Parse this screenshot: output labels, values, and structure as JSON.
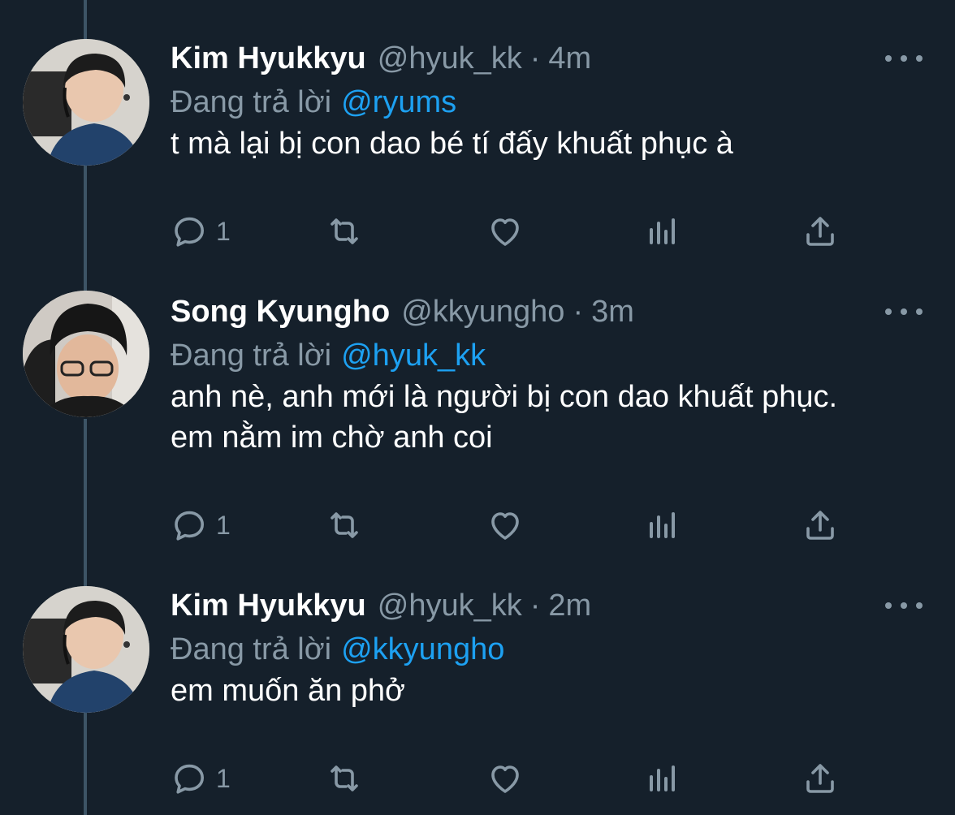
{
  "theme": {
    "background": "#15202b",
    "primary_text": "#ffffff",
    "secondary_text": "#8899a6",
    "accent": "#1da1f2",
    "thread_line": "#3d5466"
  },
  "tweets": [
    {
      "name": "Kim Hyukkyu",
      "handle": "@hyuk_kk",
      "separator": "·",
      "time": "4m",
      "reply_prefix": "Đang trả lời",
      "reply_to": "@ryums",
      "text": "t mà lại bị con dao bé tí đấy khuất phục à",
      "reply_count": "1",
      "avatar_icon": "avatar-photo"
    },
    {
      "name": "Song Kyungho",
      "handle": "@kkyungho",
      "separator": "·",
      "time": "3m",
      "reply_prefix": "Đang trả lời",
      "reply_to": "@hyuk_kk",
      "text": "anh nè, anh mới là người bị con dao khuất phục. em nằm im chờ anh coi",
      "reply_count": "1",
      "avatar_icon": "avatar-photo"
    },
    {
      "name": "Kim Hyukkyu",
      "handle": "@hyuk_kk",
      "separator": "·",
      "time": "2m",
      "reply_prefix": "Đang trả lời",
      "reply_to": "@kkyungho",
      "text": "em muốn ăn phở",
      "reply_count": "1",
      "avatar_icon": "avatar-photo"
    }
  ],
  "action_icons": [
    "reply-icon",
    "retweet-icon",
    "like-icon",
    "analytics-icon",
    "share-icon"
  ]
}
